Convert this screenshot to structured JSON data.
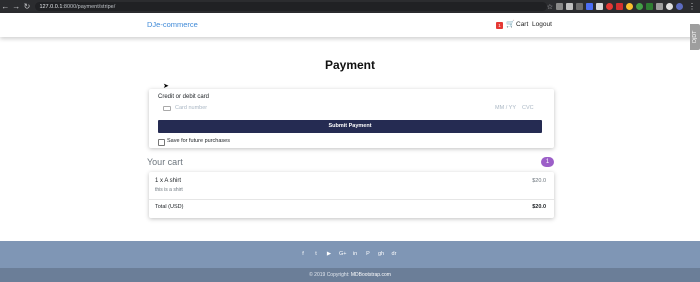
{
  "browser": {
    "url_host": "127.0.0.1",
    "url_path": ":8000/payment/stripe/",
    "back_icon": "arrow-left-icon",
    "forward_icon": "arrow-right-icon",
    "reload_icon": "reload-icon"
  },
  "navbar": {
    "brand": "DJe-commerce",
    "cart_count": "1",
    "cart_label": "Cart",
    "logout_label": "Logout",
    "side_tab": "DjDT"
  },
  "payment": {
    "title": "Payment",
    "card_heading": "Credit or debit card",
    "card_number_placeholder": "Card number",
    "expiry_placeholder": "MM / YY",
    "cvc_placeholder": "CVC",
    "submit_label": "Submit Payment",
    "save_label": "Save for future purchases"
  },
  "cart": {
    "title": "Your cart",
    "count": "1",
    "items": [
      {
        "name": "1 x A shirt",
        "description": "this is a shirt",
        "price": "$20.0"
      }
    ],
    "total_label": "Total (USD)",
    "total_value": "$20.0"
  },
  "footer": {
    "social": [
      "f",
      "t",
      "▶",
      "G+",
      "in",
      "P",
      "gh",
      "dr"
    ],
    "copyright": "© 2019 Copyright: ",
    "link": "MDBootstrap.com"
  },
  "colors": {
    "brand": "#3f8ad8",
    "submit": "#252b52",
    "badge": "#9c5fc8",
    "footer_top": "#7f96b5",
    "footer_bottom": "#6b7e98"
  }
}
